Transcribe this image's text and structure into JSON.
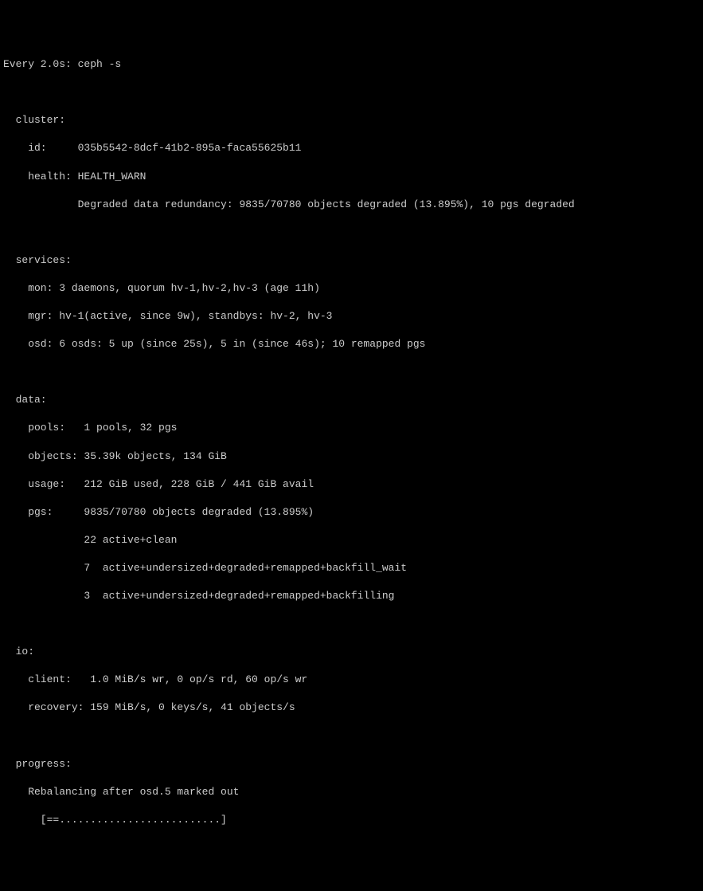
{
  "header": "Every 2.0s: ceph -s",
  "cluster": {
    "title": "  cluster:",
    "id_line": "    id:     035b5542-8dcf-41b2-895a-faca55625b11",
    "health_line": "    health: HEALTH_WARN",
    "degraded_line": "            Degraded data redundancy: 9835/70780 objects degraded (13.895%), 10 pgs degraded"
  },
  "services": {
    "title": "  services:",
    "mon_line": "    mon: 3 daemons, quorum hv-1,hv-2,hv-3 (age 11h)",
    "mgr_line": "    mgr: hv-1(active, since 9w), standbys: hv-2, hv-3",
    "osd_line": "    osd: 6 osds: 5 up (since 25s), 5 in (since 46s); 10 remapped pgs"
  },
  "data": {
    "title": "  data:",
    "pools_line": "    pools:   1 pools, 32 pgs",
    "objects_line": "    objects: 35.39k objects, 134 GiB",
    "usage_line": "    usage:   212 GiB used, 228 GiB / 441 GiB avail",
    "pgs_line": "    pgs:     9835/70780 objects degraded (13.895%)",
    "pgs_clean": "             22 active+clean",
    "pgs_wait": "             7  active+undersized+degraded+remapped+backfill_wait",
    "pgs_backfill": "             3  active+undersized+degraded+remapped+backfilling"
  },
  "io": {
    "title": "  io:",
    "client_line": "    client:   1.0 MiB/s wr, 0 op/s rd, 60 op/s wr",
    "recovery_line": "    recovery: 159 MiB/s, 0 keys/s, 41 objects/s"
  },
  "progress": {
    "title": "  progress:",
    "rebalancing_line": "    Rebalancing after osd.5 marked out",
    "bar_line": "      [==..........................]"
  }
}
